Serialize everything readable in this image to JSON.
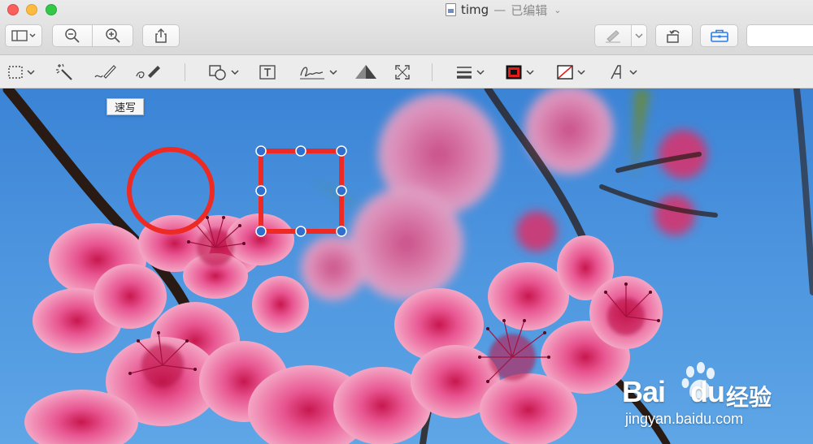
{
  "window": {
    "file_name": "timg",
    "title_separator": "—",
    "edit_status": "已编辑",
    "title_caret": "⌄"
  },
  "toolbar": {
    "buttons": [
      {
        "name": "sidebar-toggle",
        "icon": "sidebar-icon"
      },
      {
        "name": "zoom-out",
        "icon": "zoom-out-icon"
      },
      {
        "name": "zoom-in",
        "icon": "zoom-in-icon"
      },
      {
        "name": "share",
        "icon": "share-icon"
      },
      {
        "name": "markup-highlight",
        "icon": "pen-icon"
      },
      {
        "name": "rotate",
        "icon": "rotate-icon"
      },
      {
        "name": "markup-toolbox",
        "icon": "toolbox-icon"
      }
    ],
    "search_placeholder": ""
  },
  "markup_toolbar": {
    "tools": [
      {
        "name": "rectangular-selection",
        "icon": "selection-rect-icon",
        "has_dropdown": true
      },
      {
        "name": "instant-alpha",
        "icon": "magic-wand-icon",
        "has_dropdown": false
      },
      {
        "name": "sketch",
        "icon": "sketch-icon",
        "has_dropdown": false
      },
      {
        "name": "draw",
        "icon": "draw-icon",
        "has_dropdown": false
      },
      {
        "name": "shapes",
        "icon": "shapes-icon",
        "has_dropdown": true
      },
      {
        "name": "text",
        "icon": "text-box-icon",
        "has_dropdown": false
      },
      {
        "name": "sign",
        "icon": "signature-icon",
        "has_dropdown": true
      },
      {
        "name": "adjust-color",
        "icon": "adjust-color-icon",
        "has_dropdown": false
      },
      {
        "name": "adjust-size",
        "icon": "resize-icon",
        "has_dropdown": false
      },
      {
        "name": "shape-style",
        "icon": "line-style-icon",
        "has_dropdown": true
      },
      {
        "name": "border-color",
        "icon": "border-color-icon",
        "has_dropdown": true
      },
      {
        "name": "fill-color",
        "icon": "fill-color-icon",
        "has_dropdown": true
      },
      {
        "name": "text-style",
        "icon": "text-style-icon",
        "has_dropdown": true
      }
    ]
  },
  "tooltip": {
    "text": "速写"
  },
  "annotations": {
    "circle_color": "#ee2a24",
    "rect_color": "#ee2a24",
    "handle_color": "#2f6fd0"
  },
  "colors": {
    "sky": "#4c94de",
    "blossom": "#e9528f",
    "blossom_light": "#f3a2c3",
    "branch": "#2a1a14"
  },
  "watermark": {
    "brand_left": "Bai",
    "brand_right": "du",
    "product": "经验",
    "url": "jingyan.baidu.com"
  }
}
